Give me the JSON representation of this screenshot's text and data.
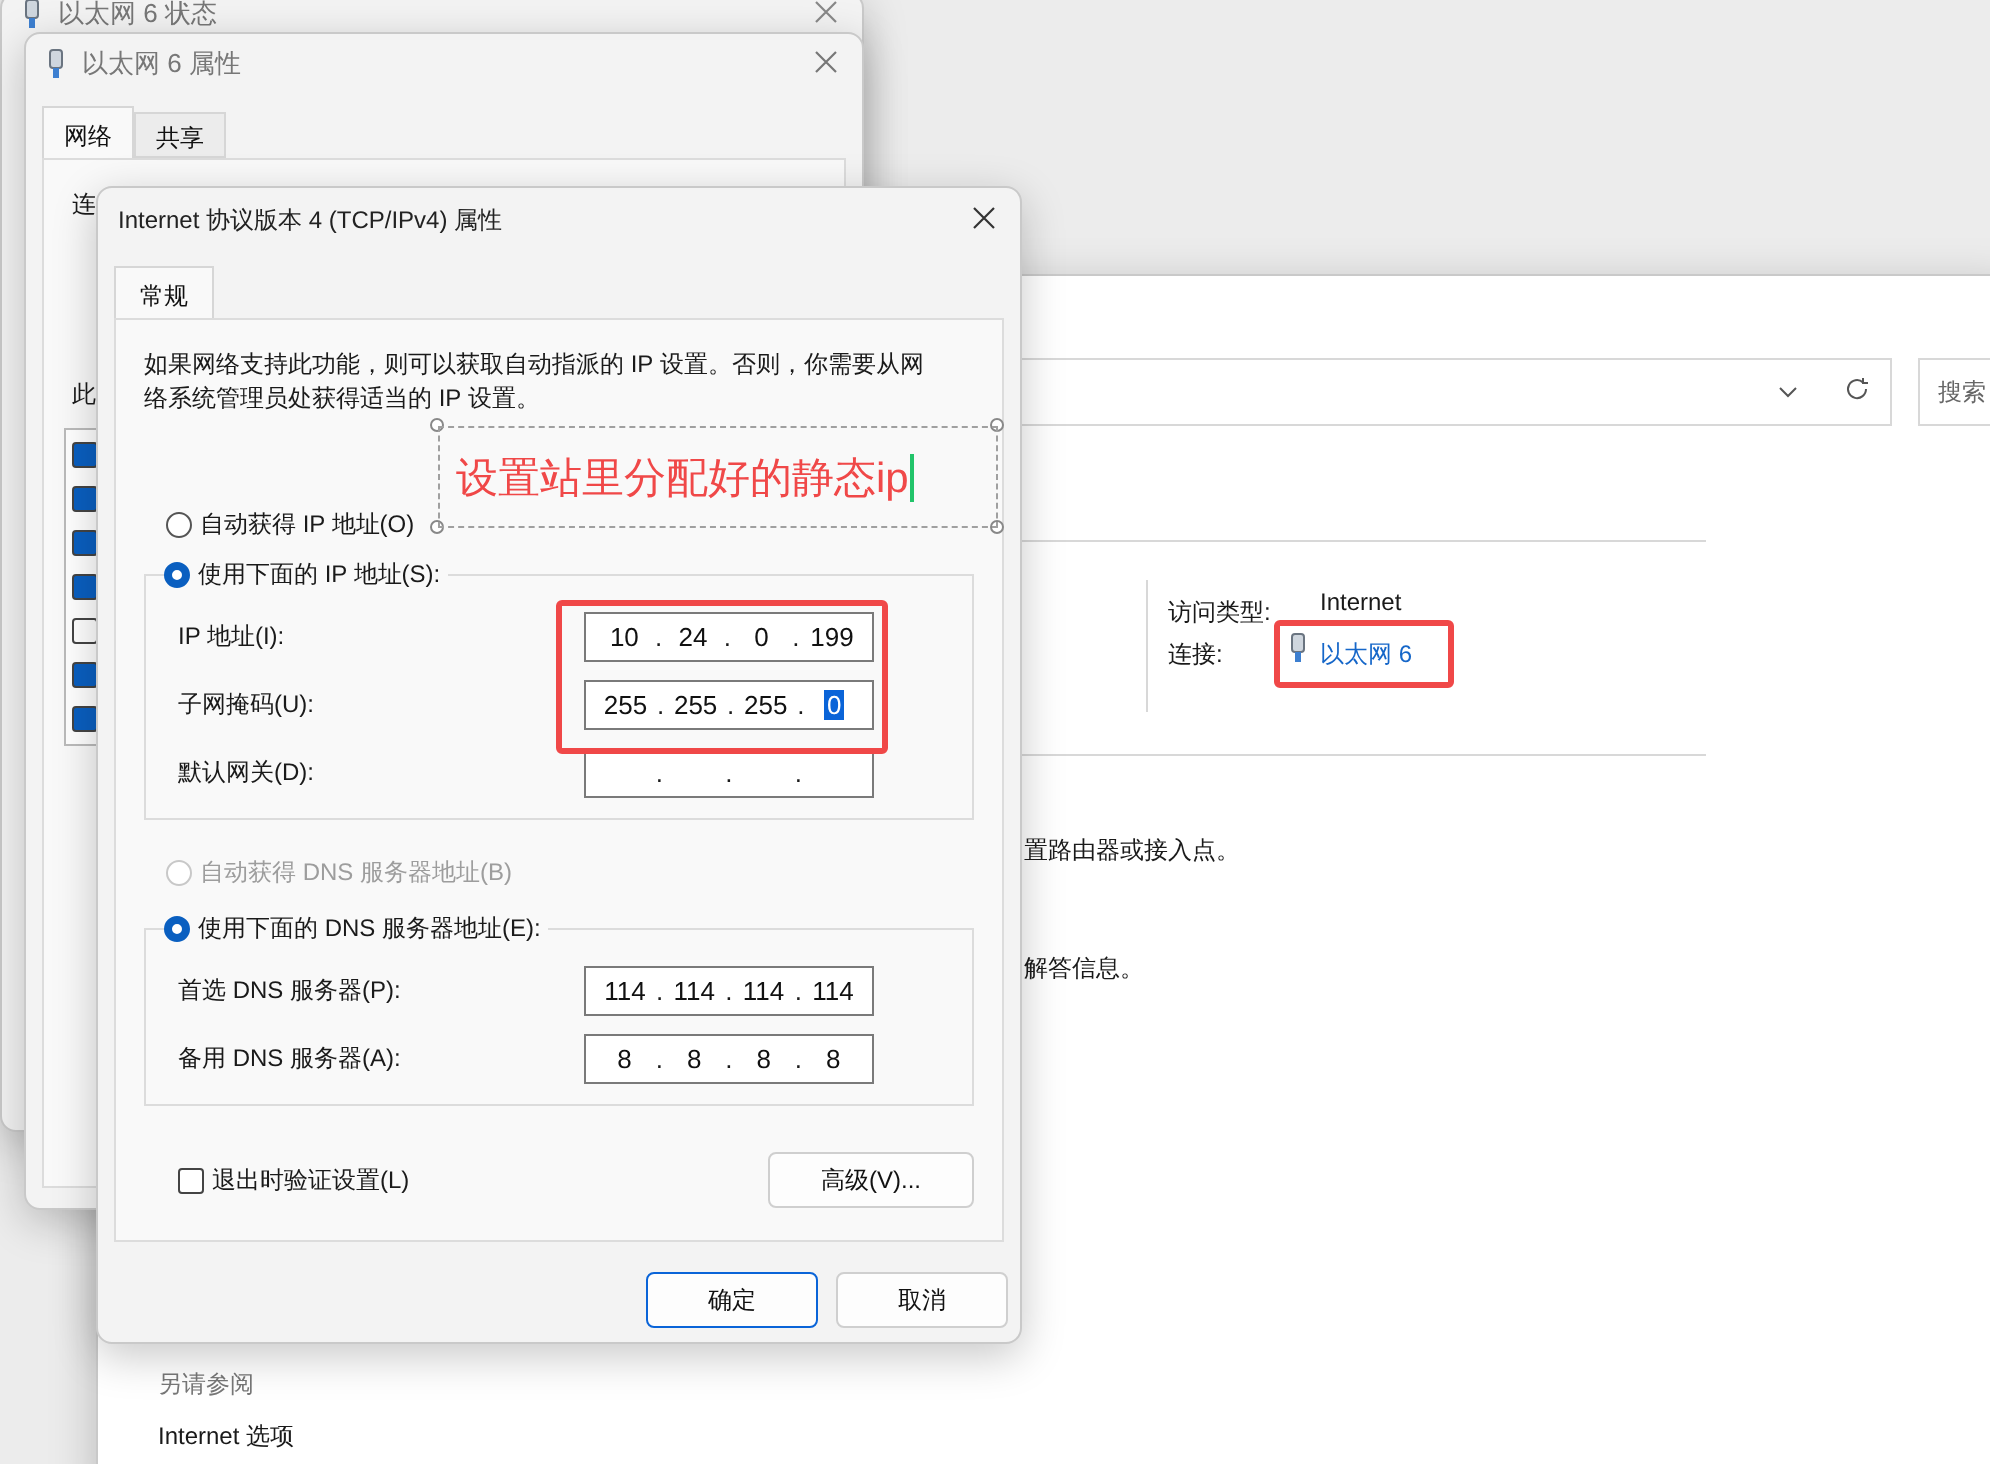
{
  "status_window": {
    "title": "以太网 6 状态"
  },
  "properties_window": {
    "title": "以太网 6 属性",
    "tabs": [
      {
        "label": "网络",
        "selected": true
      },
      {
        "label": "共享",
        "selected": false
      }
    ],
    "label_1": "连",
    "label_2": "此",
    "components": [
      {
        "checked": true
      },
      {
        "checked": true
      },
      {
        "checked": true
      },
      {
        "checked": true
      },
      {
        "checked": false
      },
      {
        "checked": true
      },
      {
        "checked": true
      }
    ]
  },
  "control_panel": {
    "search_placeholder": "搜索",
    "access_type_label": "访问类型:",
    "access_type_value": "Internet",
    "connection_label": "连接:",
    "connection_link": "以太网 6",
    "text_1": "置路由器或接入点。",
    "text_2": "解答信息。",
    "see_also": "另请参阅",
    "see_also_link": "Internet 选项"
  },
  "ipv4_dialog": {
    "title": "Internet 协议版本 4 (TCP/IPv4) 属性",
    "tabs": [
      {
        "label": "常规",
        "selected": true
      }
    ],
    "description": "如果网络支持此功能，则可以获取自动指派的 IP 设置。否则，你需要从网络系统管理员处获得适当的 IP 设置。",
    "ip_modes": [
      {
        "label": "自动获得 IP 地址(O)",
        "selected": false,
        "disabled": false
      },
      {
        "label": "使用下面的 IP 地址(S):",
        "selected": true,
        "disabled": false
      }
    ],
    "ip_fields": [
      {
        "label": "IP 地址(I):",
        "octets": [
          {
            "text": "10",
            "selected": false
          },
          {
            "text": "24",
            "selected": false
          },
          {
            "text": "0",
            "selected": false
          },
          {
            "text": "199",
            "selected": false
          }
        ]
      },
      {
        "label": "子网掩码(U):",
        "octets": [
          {
            "text": "255",
            "selected": false
          },
          {
            "text": "255",
            "selected": false
          },
          {
            "text": "255",
            "selected": false
          },
          {
            "text": "0",
            "selected": true
          }
        ]
      },
      {
        "label": "默认网关(D):"
      }
    ],
    "dns_modes": [
      {
        "label": "自动获得 DNS 服务器地址(B)",
        "selected": false,
        "disabled": true
      },
      {
        "label": "使用下面的 DNS 服务器地址(E):",
        "selected": true,
        "disabled": false
      }
    ],
    "dns_fields": [
      {
        "label": "首选 DNS 服务器(P):",
        "octets": [
          {
            "text": "114",
            "selected": false
          },
          {
            "text": "114",
            "selected": false
          },
          {
            "text": "114",
            "selected": false
          },
          {
            "text": "114",
            "selected": false
          }
        ]
      },
      {
        "label": "备用 DNS 服务器(A):",
        "octets": [
          {
            "text": "8",
            "selected": false
          },
          {
            "text": "8",
            "selected": false
          },
          {
            "text": "8",
            "selected": false
          },
          {
            "text": "8",
            "selected": false
          }
        ]
      }
    ],
    "validate_on_exit": {
      "label": "退出时验证设置(L)",
      "checked": false
    },
    "octet_separator": ".",
    "advanced_button": "高级(V)...",
    "ok_button": "确定",
    "cancel_button": "取消"
  },
  "annotation": {
    "text": "设置站里分配好的静态ip"
  }
}
